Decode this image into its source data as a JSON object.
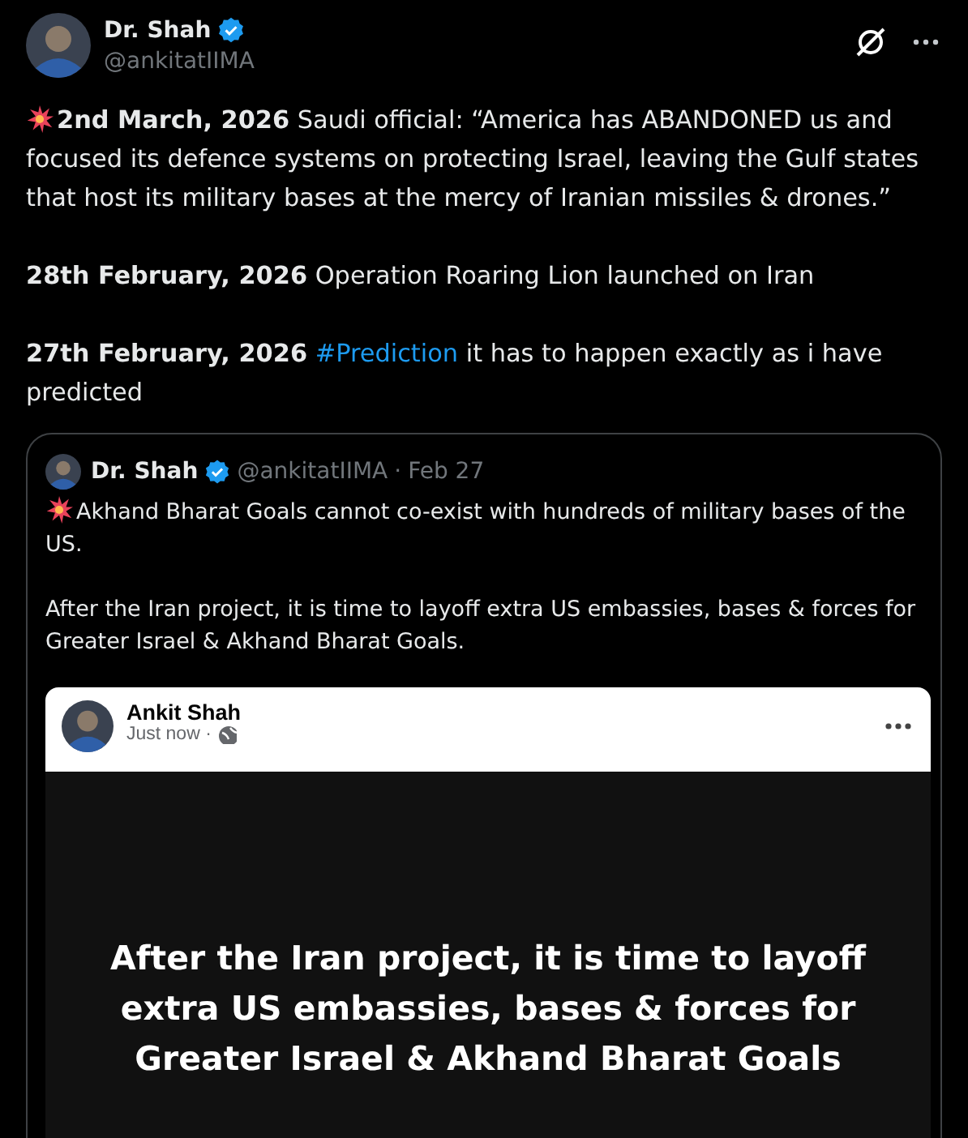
{
  "author": {
    "name": "Dr. Shah",
    "handle": "@ankitatIIMA",
    "verified": true
  },
  "paragraphs": [
    {
      "burst": true,
      "text": "**2nd March, 2026** Saudi official: “America has ABANDONED us and focused its defence systems on protecting Israel, leaving the Gulf states that host its military bases at the mercy of Iranian missiles & drones.”"
    },
    {
      "burst": false,
      "text": "**28th February, 2026** Operation Roaring Lion launched on Iran"
    },
    {
      "burst": false,
      "text": "**27th February, 2026**",
      "hashtag": "#Prediction",
      "text_after": "it has to happen exactly as i have predicted"
    }
  ],
  "quote": {
    "name": "Dr. Shah",
    "verified": true,
    "handle": "@ankitatIIMA",
    "separator": "·",
    "date": "Feb 27",
    "paragraphs": [
      {
        "burst": true,
        "text": "Akhand Bharat Goals cannot co-exist with hundreds of military bases of the US."
      },
      {
        "burst": false,
        "text": "After the Iran project, it is time to layoff extra US embassies, bases & forces for Greater Israel & Akhand Bharat Goals."
      }
    ],
    "embed": {
      "name": "Ankit Shah",
      "time": "Just now ·",
      "image_text": "After the Iran project, it is time to layoff extra US embassies, bases & forces for Greater Israel & Akhand Bharat Goals"
    }
  }
}
